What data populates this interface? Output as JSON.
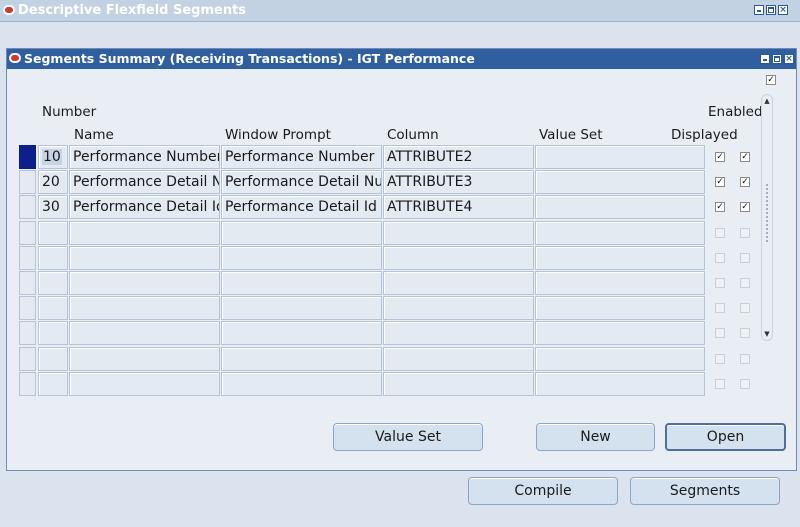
{
  "outer_window": {
    "title": "Descriptive Flexfield Segments"
  },
  "inner_window": {
    "title": "Segments Summary (Receiving Transactions) - IGT Performance"
  },
  "top_checkbox": {
    "checked": true
  },
  "headers": {
    "number": "Number",
    "name": "Name",
    "window_prompt": "Window Prompt",
    "column": "Column",
    "value_set": "Value Set",
    "enabled": "Enabled",
    "displayed": "Displayed"
  },
  "rows": [
    {
      "number": "10",
      "name": "Performance Number",
      "window_prompt": "Performance Number",
      "column": "ATTRIBUTE2",
      "value_set": "",
      "displayed": true,
      "enabled": true
    },
    {
      "number": "20",
      "name": "Performance Detail Number",
      "window_prompt": "Performance Detail Number",
      "column": "ATTRIBUTE3",
      "value_set": "",
      "displayed": true,
      "enabled": true
    },
    {
      "number": "30",
      "name": "Performance Detail Id",
      "window_prompt": "Performance Detail Id",
      "column": "ATTRIBUTE4",
      "value_set": "",
      "displayed": true,
      "enabled": true
    },
    {
      "number": "",
      "name": "",
      "window_prompt": "",
      "column": "",
      "value_set": "",
      "displayed": false,
      "enabled": false
    },
    {
      "number": "",
      "name": "",
      "window_prompt": "",
      "column": "",
      "value_set": "",
      "displayed": false,
      "enabled": false
    },
    {
      "number": "",
      "name": "",
      "window_prompt": "",
      "column": "",
      "value_set": "",
      "displayed": false,
      "enabled": false
    },
    {
      "number": "",
      "name": "",
      "window_prompt": "",
      "column": "",
      "value_set": "",
      "displayed": false,
      "enabled": false
    },
    {
      "number": "",
      "name": "",
      "window_prompt": "",
      "column": "",
      "value_set": "",
      "displayed": false,
      "enabled": false
    },
    {
      "number": "",
      "name": "",
      "window_prompt": "",
      "column": "",
      "value_set": "",
      "displayed": false,
      "enabled": false
    },
    {
      "number": "",
      "name": "",
      "window_prompt": "",
      "column": "",
      "value_set": "",
      "displayed": false,
      "enabled": false
    }
  ],
  "buttons": {
    "value_set": "Value Set",
    "new": "New",
    "open": "Open",
    "compile": "Compile",
    "segments": "Segments"
  },
  "colors": {
    "title_active": "#2f5f9e",
    "title_inactive": "#c3d2e3",
    "row_indicator_active": "#0d1f8c"
  }
}
